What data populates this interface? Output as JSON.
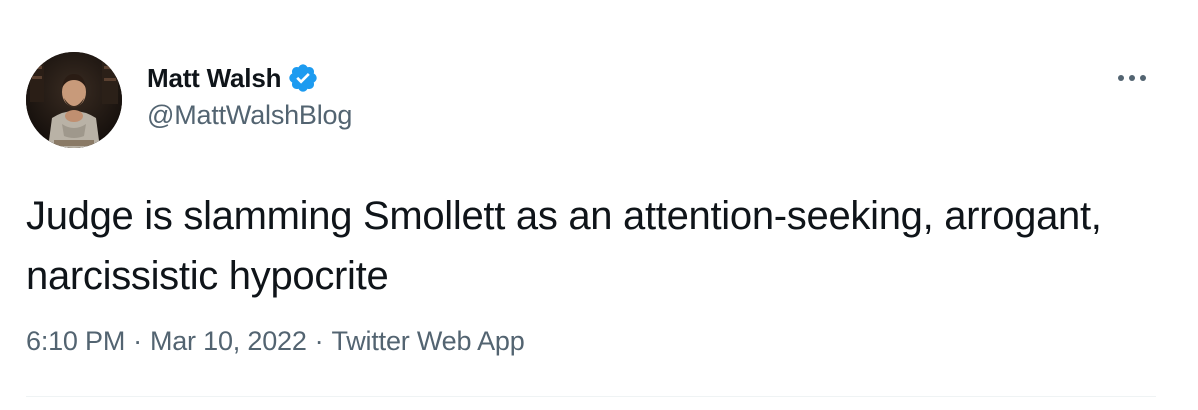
{
  "tweet": {
    "author": {
      "display_name": "Matt Walsh",
      "handle": "@MattWalshBlog",
      "verified": true,
      "verified_color": "#1d9bf0"
    },
    "text": "Judge is slamming Smollett as an attention-seeking, arrogant, narcissistic hypocrite",
    "time": "6:10 PM",
    "date": "Mar 10, 2022",
    "source": "Twitter Web App",
    "separator": "·"
  },
  "icons": {
    "verified": "verified-badge-icon",
    "more": "more-dots-icon"
  },
  "colors": {
    "text_primary": "#0f1419",
    "text_secondary": "#536471",
    "divider": "#eff3f4"
  }
}
